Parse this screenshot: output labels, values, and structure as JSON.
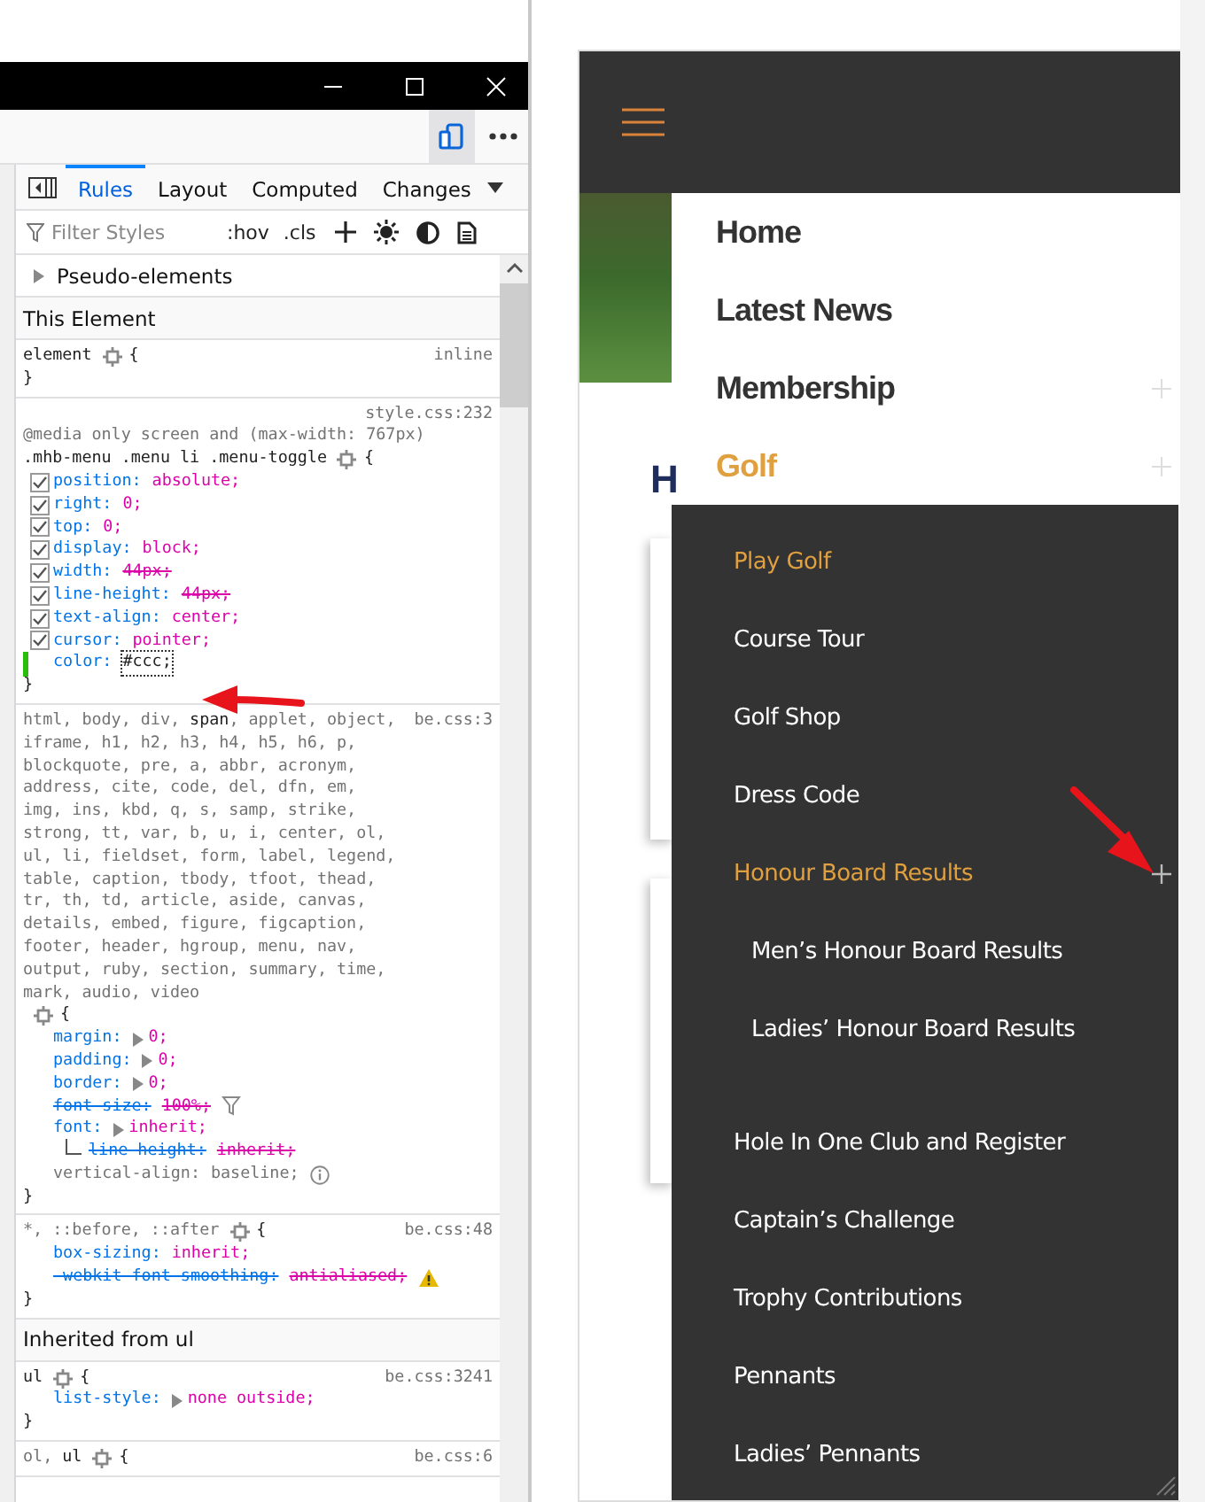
{
  "devtools": {
    "tabs": [
      {
        "label": "Rules",
        "selected": true
      },
      {
        "label": "Layout",
        "selected": false
      },
      {
        "label": "Computed",
        "selected": false
      },
      {
        "label": "Changes",
        "selected": false
      }
    ],
    "filter": {
      "placeholder": "Filter Styles"
    },
    "toggles": [
      ":hov",
      ".cls"
    ],
    "blocks": [
      {
        "kind": "group",
        "label": "Pseudo-elements",
        "expanded": false
      },
      {
        "kind": "section",
        "label": "This Element"
      },
      {
        "kind": "rule",
        "source": "inline",
        "selector": [
          {
            "text": "element",
            "matched": true
          }
        ],
        "open": "{",
        "close": "}"
      },
      {
        "kind": "rule",
        "source": "style.css:232",
        "media": "@media only screen and (max-width: 767px)",
        "selector": [
          {
            "text": ".mhb-menu .menu li .menu-toggle",
            "matched": true
          }
        ],
        "open": "{",
        "declarations": [
          {
            "property": "position:",
            "value": "absolute;",
            "checked": true
          },
          {
            "property": "right:",
            "value": "0;",
            "checked": true
          },
          {
            "property": "top:",
            "value": "0;",
            "checked": true
          },
          {
            "property": "display:",
            "value": "block;",
            "checked": true
          },
          {
            "property": "width:",
            "value": "44px;",
            "checked": true,
            "value_overridden": true
          },
          {
            "property": "line-height:",
            "value": "44px;",
            "checked": true,
            "value_overridden": true
          },
          {
            "property": "text-align:",
            "value": "center;",
            "checked": true
          },
          {
            "property": "cursor:",
            "value": "pointer;",
            "checked": true
          },
          {
            "property": "color:",
            "value": "#ccc;",
            "changed": true,
            "editing": true
          }
        ],
        "close": "}"
      },
      {
        "kind": "rule",
        "source": "be.css:3",
        "selector": [
          {
            "text": "html, body, div, ",
            "matched": false
          },
          {
            "text": "span",
            "matched": true
          },
          {
            "text": ", applet, object, iframe, h1, h2, h3, h4, h5, h6, p, blockquote, pre, a, abbr, acronym, address, cite, code, del, dfn, em, img, ins, kbd, q, s, samp, strike, strong, tt, var, b, u, i, center, ol, ul, li, fieldset, form, label, legend, table, caption, tbody, tfoot, thead, tr, th, td, article, aside, canvas, details, embed, figure, figcaption, footer, header, hgroup, menu, nav, output, ruby, section, summary, time, mark, audio, video",
            "matched": false
          }
        ],
        "open": "{",
        "declarations": [
          {
            "property": "margin:",
            "value": "0;",
            "expander": true
          },
          {
            "property": "padding:",
            "value": "0;",
            "expander": true
          },
          {
            "property": "border:",
            "value": "0;",
            "expander": true
          },
          {
            "property": "font-size:",
            "value": "100%;",
            "overridden": true,
            "kind": "filter"
          },
          {
            "property": "font:",
            "value": "inherit;",
            "expander": true,
            "children": [
              {
                "property": "line height:",
                "value": "inherit;",
                "overridden": true
              }
            ]
          },
          {
            "property": "vertical-align:",
            "value": "baseline;",
            "inactive": true,
            "kind": "info"
          }
        ],
        "close": "}"
      },
      {
        "kind": "rule",
        "source": "be.css:48",
        "selector": [
          {
            "text": "*, ::before, ::after",
            "matched": false
          }
        ],
        "open": "{",
        "declarations": [
          {
            "property": "box-sizing:",
            "value": "inherit;"
          },
          {
            "property": "-webkit-font-smoothing:",
            "value": "antialiased;",
            "overridden": true,
            "kind": "warning"
          }
        ],
        "close": "}"
      },
      {
        "kind": "section",
        "label": "Inherited from ul"
      },
      {
        "kind": "rule",
        "source": "be.css:3241",
        "selector": [
          {
            "text": "ul",
            "matched": true
          }
        ],
        "open": "{",
        "declarations": [
          {
            "property": "list-style:",
            "value": "none outside;",
            "expander": true
          }
        ],
        "close": "}"
      },
      {
        "kind": "rule",
        "source": "be.css:6",
        "selector": [
          {
            "text": "ol, ",
            "matched": false
          },
          {
            "text": "ul",
            "matched": true
          }
        ],
        "open": "{"
      }
    ]
  },
  "site": {
    "heading": "H",
    "menu": [
      {
        "label": "Home",
        "current": false,
        "expandable": false
      },
      {
        "label": "Latest News",
        "current": false,
        "expandable": false
      },
      {
        "label": "Membership",
        "current": false,
        "expandable": true
      },
      {
        "label": "Golf",
        "current": true,
        "expandable": true,
        "children": [
          {
            "label": "Play Golf",
            "current": true,
            "expandable": false
          },
          {
            "label": "Course Tour",
            "current": false,
            "expandable": false
          },
          {
            "label": "Golf Shop",
            "current": false,
            "expandable": false
          },
          {
            "label": "Dress Code",
            "current": false,
            "expandable": false
          },
          {
            "label": "Honour Board Results",
            "current": true,
            "expandable": true,
            "children": [
              {
                "label": "Men’s Honour Board Results",
                "current": false,
                "expandable": false
              },
              {
                "label": "Ladies’ Honour Board Results",
                "current": false,
                "expandable": false
              }
            ]
          },
          {
            "label": "Hole In One Club and Register",
            "current": false,
            "expandable": false
          },
          {
            "label": "Captain’s Challenge",
            "current": false,
            "expandable": false
          },
          {
            "label": "Trophy Contributions",
            "current": false,
            "expandable": false
          },
          {
            "label": "Pennants",
            "current": false,
            "expandable": false
          },
          {
            "label": "Ladies’ Pennants",
            "current": false,
            "expandable": false
          }
        ]
      }
    ]
  }
}
